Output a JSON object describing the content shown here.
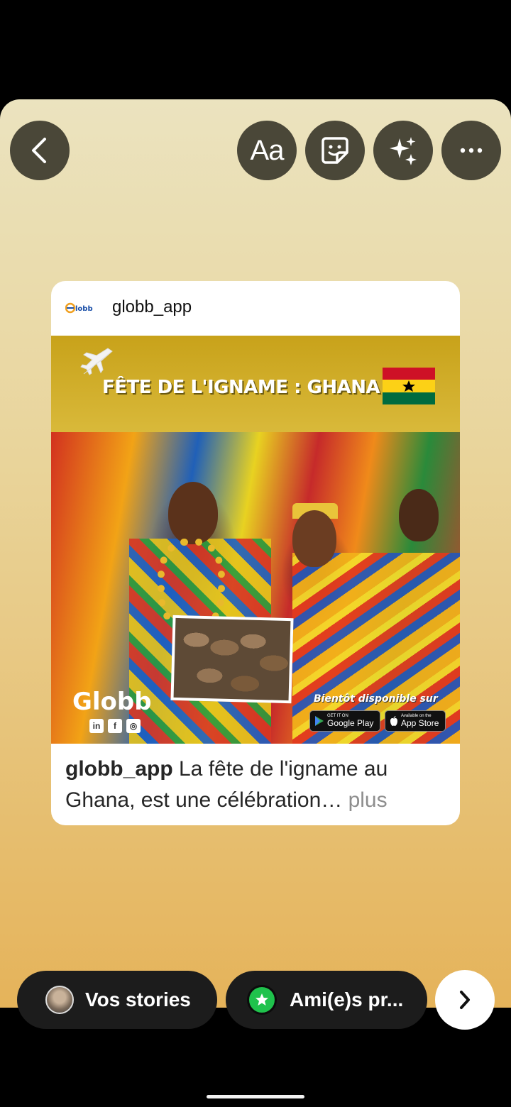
{
  "toolbar": {
    "back_icon": "chevron-left-icon",
    "text_label": "Aa",
    "sticker_icon": "sticker-icon",
    "effects_icon": "sparkles-icon",
    "more_icon": "more-horizontal-icon"
  },
  "post": {
    "username": "globb_app",
    "logo_text": "Globb",
    "banner_title": "FÊTE DE L'IGNAME : GHANA",
    "brand_overlay": "Globb",
    "availability_text": "Bientôt disponible sur",
    "google_play_small": "GET IT ON",
    "google_play_big": "Google Play",
    "app_store_small": "Available on the",
    "app_store_big": "App Store",
    "caption_username": "globb_app",
    "caption_text": " La fête de l'igname au Ghana, est une célébration…",
    "caption_more": " plus"
  },
  "share": {
    "your_stories": "Vos stories",
    "close_friends": "Ami(e)s pr...",
    "next_icon": "chevron-right-icon"
  },
  "colors": {
    "button_bg": "#4a4738",
    "pill_bg": "#1c1c1c",
    "close_friends_green": "#1fc24c"
  }
}
